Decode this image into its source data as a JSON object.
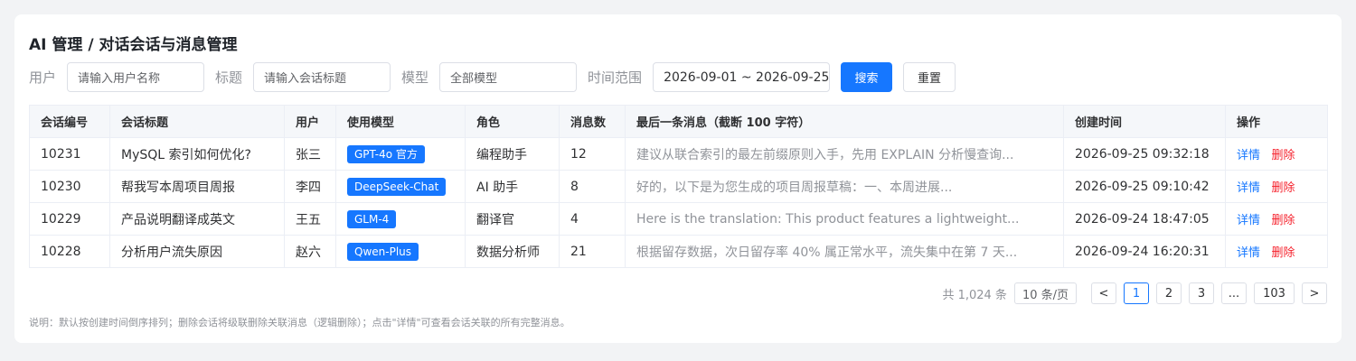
{
  "page": {
    "title": "AI 管理 / 对话会话与消息管理"
  },
  "filters": {
    "user_label": "用户",
    "user_placeholder": "请输入用户名称",
    "title_label": "标题",
    "title_placeholder": "请输入会话标题",
    "model_label": "模型",
    "model_value": "全部模型",
    "time_label": "时间范围",
    "time_value": "2026-09-01 ~ 2026-09-25",
    "search_label": "搜索",
    "reset_label": "重置"
  },
  "table": {
    "headers": [
      "会话编号",
      "会话标题",
      "用户",
      "使用模型",
      "角色",
      "消息数",
      "最后一条消息（截断 100 字符）",
      "创建时间",
      "操作"
    ],
    "rows": [
      {
        "id": "10231",
        "title": "MySQL 索引如何优化?",
        "user": "张三",
        "model": "GPT-4o 官方",
        "role": "编程助手",
        "count": "12",
        "last": "建议从联合索引的最左前缀原则入手，先用 EXPLAIN 分析慢查询...",
        "created": "2026-09-25 09:32:18",
        "detail": "详情",
        "delete": "删除"
      },
      {
        "id": "10230",
        "title": "帮我写本周项目周报",
        "user": "李四",
        "model": "DeepSeek-Chat",
        "role": "AI 助手",
        "count": "8",
        "last": "好的，以下是为您生成的项目周报草稿：一、本周进展...",
        "created": "2026-09-25 09:10:42",
        "detail": "详情",
        "delete": "删除"
      },
      {
        "id": "10229",
        "title": "产品说明翻译成英文",
        "user": "王五",
        "model": "GLM-4",
        "role": "翻译官",
        "count": "4",
        "last": "Here is the translation: This product features a lightweight...",
        "created": "2026-09-24 18:47:05",
        "detail": "详情",
        "delete": "删除"
      },
      {
        "id": "10228",
        "title": "分析用户流失原因",
        "user": "赵六",
        "model": "Qwen-Plus",
        "role": "数据分析师",
        "count": "21",
        "last": "根据留存数据，次日留存率 40% 属正常水平，流失集中在第 7 天...",
        "created": "2026-09-24 16:20:31",
        "detail": "详情",
        "delete": "删除"
      }
    ]
  },
  "pagination": {
    "total": "共 1,024 条",
    "page_size": "10 条/页",
    "prev": "<",
    "pages": [
      "1",
      "2",
      "3"
    ],
    "ellipsis": "...",
    "last_page": "103",
    "next": ">",
    "current": "1"
  },
  "note": "说明：默认按创建时间倒序排列；删除会话将级联删除关联消息（逻辑删除）；点击\"详情\"可查看会话关联的所有完整消息。",
  "colors": {
    "primary": "#1677ff",
    "danger": "#f5222d"
  }
}
